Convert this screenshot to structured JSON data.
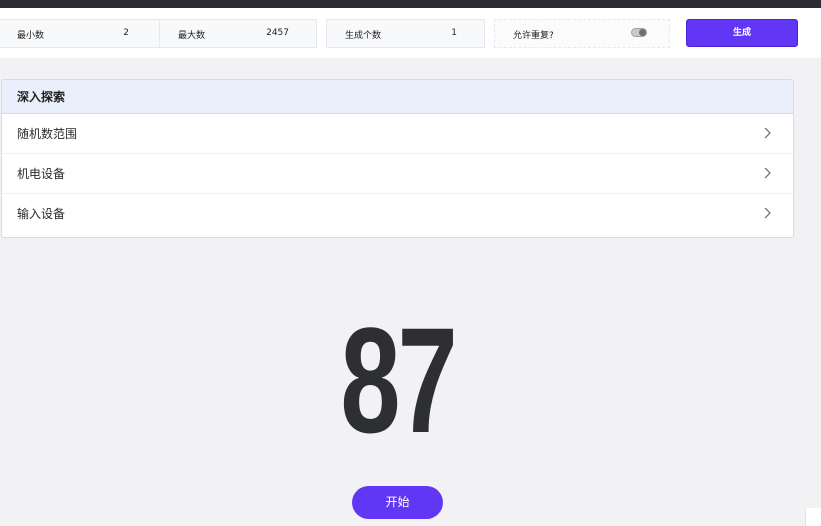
{
  "controls": {
    "min": {
      "label": "最小数",
      "value": "2"
    },
    "max": {
      "label": "最大数",
      "value": "2457"
    },
    "count": {
      "label": "生成个数",
      "value": "1"
    },
    "allow_repeat": {
      "label": "允许重复?",
      "enabled": true
    },
    "generate_label": "生成"
  },
  "panel": {
    "title": "深入探索",
    "items": [
      {
        "label": "随机数范围",
        "icon": "chevron-right-icon"
      },
      {
        "label": "机电设备",
        "icon": "chevron-right-icon"
      },
      {
        "label": "输入设备",
        "icon": "chevron-right-icon"
      }
    ]
  },
  "result": {
    "value": "87"
  },
  "start_label": "开始",
  "colors": {
    "accent": "#6236f5",
    "number": "#2e2f33",
    "panel_header": "#e9f0fb"
  }
}
